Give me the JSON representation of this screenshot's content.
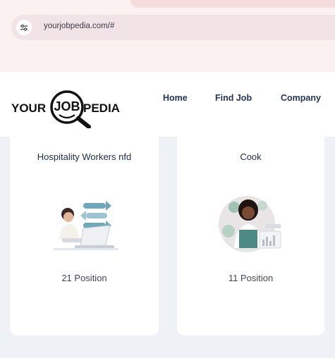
{
  "browser": {
    "url": "yourjobpedia.com/#"
  },
  "logo": {
    "text_left": "YOUR",
    "text_mid": "JOB",
    "text_right": "PEDIA"
  },
  "nav": {
    "items": [
      {
        "label": "Home"
      },
      {
        "label": "Find Job"
      },
      {
        "label": "Company"
      }
    ]
  },
  "categories": [
    {
      "title": "Hospitality Workers nfd",
      "count": "21 Position",
      "illustration": "person-at-laptop"
    },
    {
      "title": "Cook",
      "count": "11 Position",
      "illustration": "woman-with-charts"
    }
  ],
  "colors": {
    "brand_navy": "#23335a",
    "accent_teal": "#6fa8b8",
    "page_bg": "#eef2f6"
  }
}
